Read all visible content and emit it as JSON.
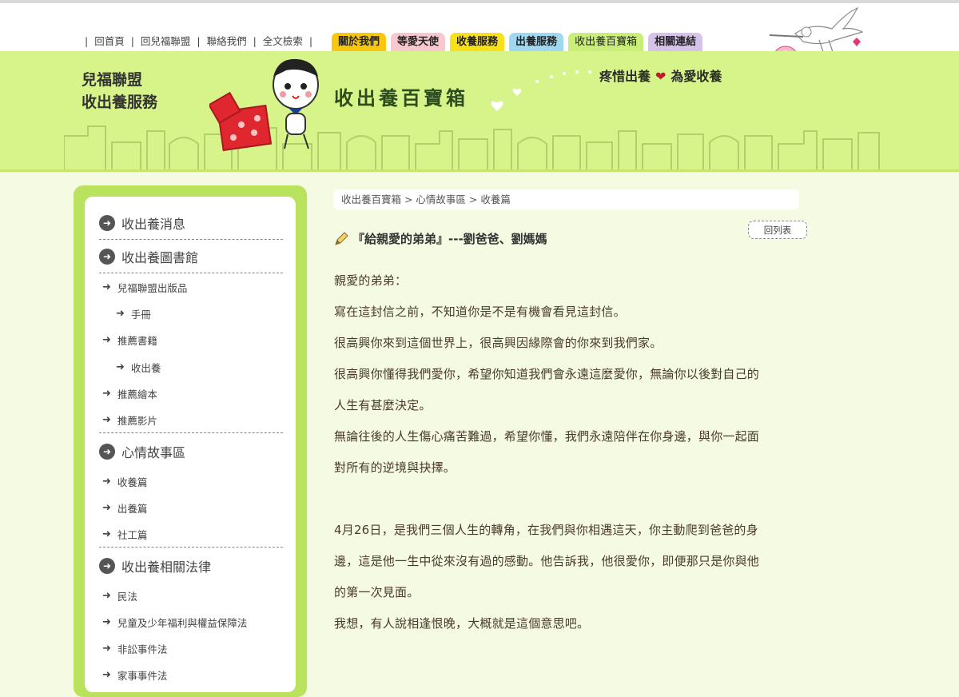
{
  "utility_links": [
    "回首頁",
    "回兒福聯盟",
    "聯絡我們",
    "全文檢索"
  ],
  "nav_tabs": [
    {
      "label": "關於我們",
      "color": "#f9c80e"
    },
    {
      "label": "等愛天使",
      "color": "#f8c8cf"
    },
    {
      "label": "收養服務",
      "color": "#f9e11a"
    },
    {
      "label": "出養服務",
      "color": "#9fd8f0"
    },
    {
      "label": "收出養百寶箱",
      "color": "#c9ef7a"
    },
    {
      "label": "相關連結",
      "color": "#d6c3ea"
    }
  ],
  "site_name": {
    "line1": "兒福聯盟",
    "line2": "收出養服務"
  },
  "page_heading": "收出養百寶箱",
  "slogan": {
    "left": "疼惜出養",
    "heart": "❤",
    "right": "為愛收養"
  },
  "sidebar": {
    "sections": [
      {
        "label": "收出養消息"
      },
      {
        "label": "收出養圖書館"
      },
      {
        "label": "心情故事區"
      },
      {
        "label": "收出養相關法律"
      }
    ],
    "library_items": [
      {
        "label": "兒福聯盟出版品"
      },
      {
        "label": "手冊"
      },
      {
        "label": "推薦書籍"
      },
      {
        "label": "收出養"
      },
      {
        "label": "推薦繪本"
      },
      {
        "label": "推薦影片"
      }
    ],
    "story_items": [
      {
        "label": "收養篇"
      },
      {
        "label": "出養篇"
      },
      {
        "label": "社工篇"
      }
    ],
    "law_items": [
      {
        "label": "民法"
      },
      {
        "label": "兒童及少年福利與權益保障法"
      },
      {
        "label": "非訟事件法"
      },
      {
        "label": "家事事件法"
      }
    ]
  },
  "breadcrumb": "收出養百寶箱 > 心情故事區 > 收養篇",
  "back_button": "回列表",
  "article": {
    "title": "『給親愛的弟弟』---劉爸爸、劉媽媽",
    "paragraphs": [
      "親愛的弟弟：",
      "寫在這封信之前，不知道你是不是有機會看見這封信。",
      "很高興你來到這個世界上，很高興因緣際會的你來到我們家。",
      "很高興你懂得我們愛你，希望你知道我們會永遠這麼愛你，無論你以後對自己的",
      "人生有甚麼決定。",
      "無論往後的人生傷心痛苦難過，希望你懂，我們永遠陪伴在你身邊，與你一起面",
      "對所有的逆境與抉擇。",
      "",
      "4月26日，是我們三個人生的轉角，在我們與你相遇這天，你主動爬到爸爸的身",
      "邊，這是他一生中從來沒有過的感動。他告訴我，他很愛你，即便那只是你與他",
      "的第一次見面。",
      "我想，有人說相逢恨晚，大概就是這個意思吧。"
    ]
  },
  "colors": {
    "banner": "#d7f48a",
    "sidebar_frame": "#b9e25d",
    "page_bg": "#f4fbe2"
  }
}
